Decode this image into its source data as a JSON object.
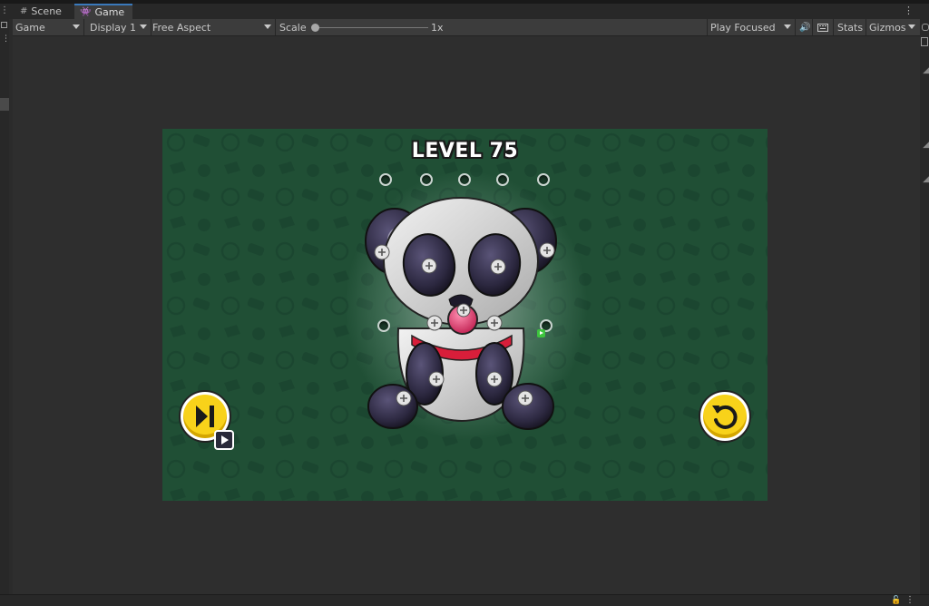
{
  "tabs": [
    {
      "label": "Scene",
      "icon": "grid-icon"
    },
    {
      "label": "Game",
      "icon": "gamepad-icon"
    }
  ],
  "toolbar": {
    "view_select": "Game",
    "display_select": "Display 1",
    "aspect_select": "Free Aspect",
    "scale_label": "Scale",
    "scale_value": "1x",
    "scale_fraction": 0.0,
    "play_mode_select": "Play Focused",
    "stats_label": "Stats",
    "gizmos_label": "Gizmos"
  },
  "game": {
    "level_title": "LEVEL 75",
    "background_color": "#204f35",
    "accent_yellow": "#f8d21a",
    "panda_accent_red": "#d81e3a"
  }
}
